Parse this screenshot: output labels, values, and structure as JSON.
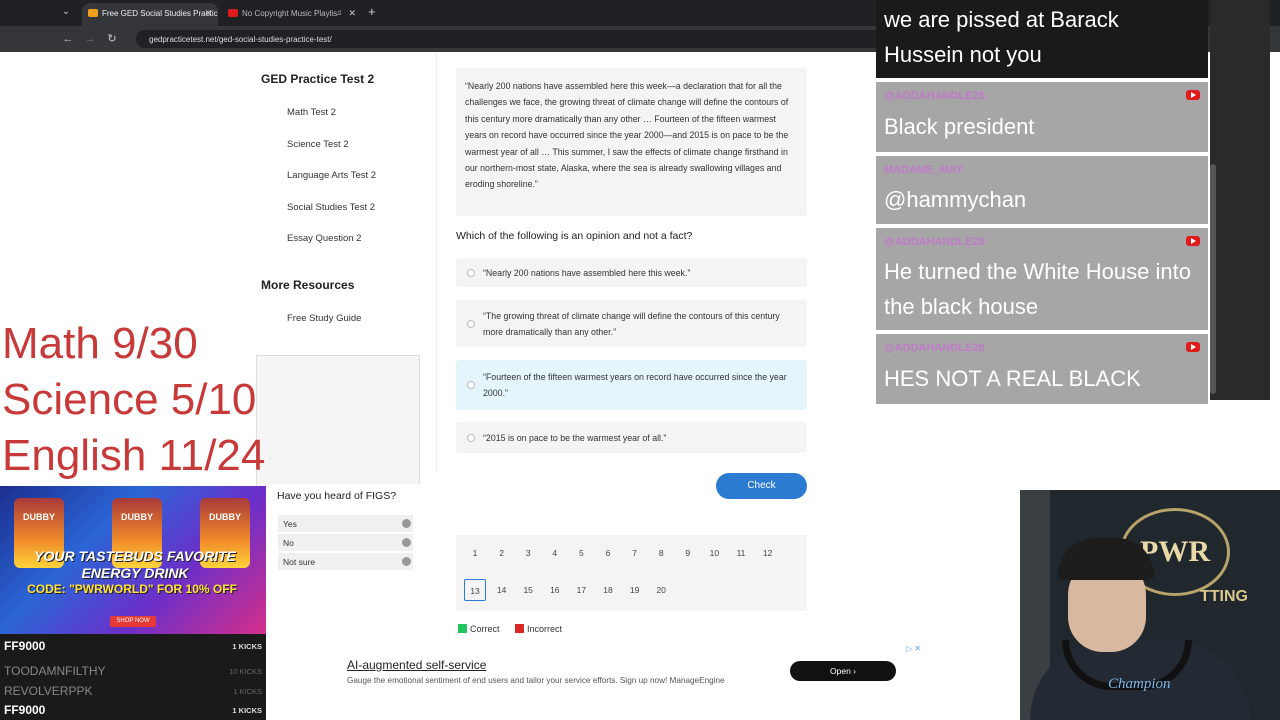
{
  "browser": {
    "tabs": [
      {
        "label": "Free GED Social Studies Practic"
      },
      {
        "label": "No Copyright Music Playlis"
      }
    ],
    "url": "gedpracticetest.net/ged-social-studies-practice-test/"
  },
  "sidebar": {
    "title": "GED Practice Test 2",
    "links": [
      "Math Test 2",
      "Science Test 2",
      "Language Arts Test 2",
      "Social Studies Test 2",
      "Essay Question 2"
    ],
    "resources_title": "More Resources",
    "resources": [
      "Free Study Guide"
    ]
  },
  "quiz": {
    "passage": "“Nearly 200 nations have assembled here this week—a declaration that for all the challenges we face, the growing threat of climate change will define the contours of this century more dramatically than any other … Fourteen of the fifteen warmest years on record have occurred since the year 2000—and 2015 is on pace to be the warmest year of all … This summer, I saw the effects of climate change firsthand in our northern-most state, Alaska, where the sea is already swallowing villages and eroding shoreline.”",
    "question": "Which of the following is an opinion and not a fact?",
    "options": [
      "“Nearly 200 nations have assembled here this week.”",
      "“The growing threat of climate change will define the contours of this century more dramatically than any other.”",
      "“Fourteen of the fifteen warmest years on record have occurred since the year 2000.”",
      "“2015 is on pace to be the warmest year of all.”"
    ],
    "hovered_option": 2,
    "check_label": "Check",
    "pages_row1": [
      "1",
      "2",
      "3",
      "4",
      "5",
      "6",
      "7",
      "8",
      "9",
      "10",
      "11",
      "12"
    ],
    "pages_row2": [
      "13",
      "14",
      "15",
      "16",
      "17",
      "18",
      "19",
      "20"
    ],
    "current_page": "13",
    "legend_correct": "Correct",
    "legend_incorrect": "Incorrect",
    "correct_color": "#22c55e",
    "incorrect_color": "#dc2626"
  },
  "ad": {
    "headline": "AI-augmented self-service",
    "text": "Gauge the emotional sentiment of end users and tailor your service efforts. Sign up now! ManageEngine",
    "open_label": "Open"
  },
  "poll": {
    "title": "Have you heard of FIGS?",
    "options": [
      "Yes",
      "No",
      "Not sure"
    ]
  },
  "scores": [
    "Math 9/30",
    "Science 5/10",
    "English 11/24"
  ],
  "drink_ad": {
    "can_brand": "DUBBY",
    "tagline": "YOUR TASTEBUDS FAVORITE ENERGY DRINK",
    "code": "CODE: \"PWRWORLD\" FOR 10% OFF",
    "shop": "SHOP NOW"
  },
  "kicks": [
    {
      "name": "FF9000",
      "count": "1 KICKS"
    },
    {
      "name": "TOODAMNFILTHY",
      "count": "10 KICKS"
    },
    {
      "name": "REVOLVERPPK",
      "count": "1 KICKS"
    },
    {
      "name": "FF9000",
      "count": "1 KICKS"
    }
  ],
  "chat": {
    "messages": [
      {
        "name": "",
        "text": "we are pissed at Barack Hussein not you"
      },
      {
        "name": "@ADDAHANDLE28",
        "text": "Black president"
      },
      {
        "name": "MADAME_MAY",
        "text": "@hammychan"
      },
      {
        "name": "@ADDAHANDLE28",
        "text": "He turned the White House into the black house"
      },
      {
        "name": "@ADDAHANDLE28",
        "text": "HES NOT A REAL BLACK PERSON"
      }
    ]
  },
  "webcam": {
    "banner_logo": "PWR",
    "banner_text": "TTING",
    "shirt_text": "Champion"
  }
}
